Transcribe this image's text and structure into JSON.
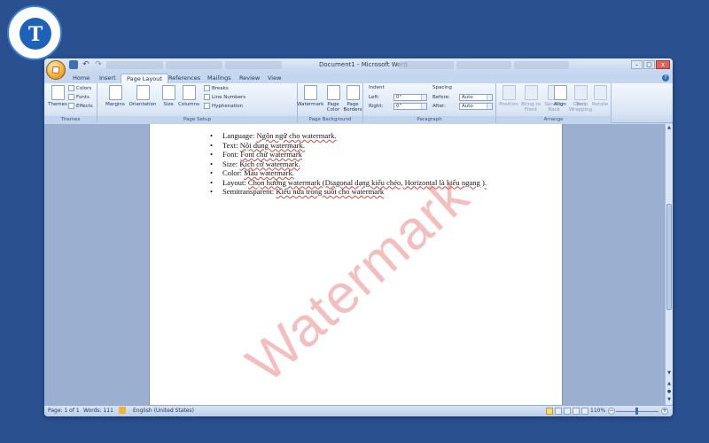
{
  "logo": {
    "letter": "T"
  },
  "window": {
    "title": "Document1 - Microsoft Word",
    "controls": {
      "minimize": "–",
      "maximize": "□",
      "close": "x"
    }
  },
  "tabs": [
    {
      "label": "Home",
      "active": false
    },
    {
      "label": "Insert",
      "active": false
    },
    {
      "label": "Page Layout",
      "active": true
    },
    {
      "label": "References",
      "active": false
    },
    {
      "label": "Mailings",
      "active": false
    },
    {
      "label": "Review",
      "active": false
    },
    {
      "label": "View",
      "active": false
    }
  ],
  "ribbon": {
    "themes": {
      "label": "Themes",
      "colors": "Colors",
      "fonts": "Fonts",
      "effects": "Effects",
      "group": "Themes"
    },
    "page_setup": {
      "margins": "Margins",
      "orientation": "Orientation",
      "size": "Size",
      "columns": "Columns",
      "breaks": "Breaks",
      "line_numbers": "Line Numbers",
      "hyphenation": "Hyphenation",
      "group": "Page Setup"
    },
    "page_background": {
      "watermark": "Watermark",
      "page_color": "Page Color",
      "page_borders": "Page Borders",
      "group": "Page Background"
    },
    "paragraph": {
      "indent_title": "Indent",
      "left_label": "Left:",
      "left_value": "0\"",
      "right_label": "Right:",
      "right_value": "0\"",
      "spacing_title": "Spacing",
      "before_label": "Before:",
      "before_value": "Auto",
      "after_label": "After:",
      "after_value": "Auto",
      "group": "Paragraph"
    },
    "arrange": {
      "position": "Position",
      "bring_to_front": "Bring to Front",
      "send_to_back": "Send to Back",
      "text_wrapping": "Text Wrapping",
      "align": "Align",
      "group_btn": "Group",
      "rotate": "Rotate",
      "group": "Arrange"
    }
  },
  "document": {
    "items": [
      {
        "label": "Language:",
        "text": "Ngôn ngữ cho watermark."
      },
      {
        "label": "Text:",
        "text": "Nội dung watermark."
      },
      {
        "label": "Font:",
        "text": "Font chữ watermark"
      },
      {
        "label": "Size:",
        "text": "Kích cỡ watermark."
      },
      {
        "label": "Color:",
        "text": "Màu watermark."
      },
      {
        "label": "Layout:",
        "text": "Chọn hướng watermark (Diagonal dạng kiểu chéo, Horizontal là kiểu ngang )."
      },
      {
        "label": "Semitransparent:",
        "text": "Kiểu nửa trong suốt cho watermark"
      }
    ],
    "watermark": "Watermark",
    "watermark_color": "#e86e6e"
  },
  "status": {
    "page": "Page: 1 of 1",
    "words": "Words: 111",
    "language": "English (United States)",
    "zoom": "110%"
  }
}
